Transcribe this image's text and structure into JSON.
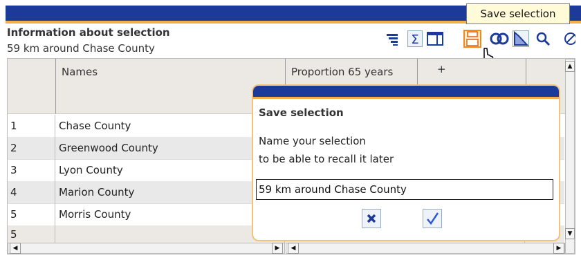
{
  "panel": {
    "title": "Information about selection",
    "subtitle": "59 km around Chase County"
  },
  "tooltip": "Save selection",
  "toolbar": {
    "icons": [
      "sort-icon",
      "sum-icon",
      "columns-icon",
      "save-icon",
      "link-rings-icon",
      "chart-icon",
      "zoom-icon",
      "clear-icon"
    ]
  },
  "grid": {
    "columns": [
      "Names",
      "Proportion 65 years",
      "+"
    ],
    "rows": [
      {
        "num": "1",
        "name": "Chase County"
      },
      {
        "num": "2",
        "name": "Greenwood County"
      },
      {
        "num": "3",
        "name": "Lyon County"
      },
      {
        "num": "4",
        "name": "Marion County"
      },
      {
        "num": "5",
        "name": "Morris County"
      }
    ],
    "footer_count": "5"
  },
  "dialog": {
    "title": "Save selection",
    "line1": "Name your selection",
    "line2": "to be able to recall it later",
    "input_value": "59 km around Chase County",
    "cancel_icon": "cancel-icon",
    "confirm_icon": "confirm-check-icon"
  },
  "colors": {
    "title_bar": "#1b3a9a",
    "accent_orange": "#f2b04a",
    "header_bg": "#ece9e4",
    "alt_row": "#e9e9e9",
    "tooltip_bg": "#fffbd8"
  }
}
